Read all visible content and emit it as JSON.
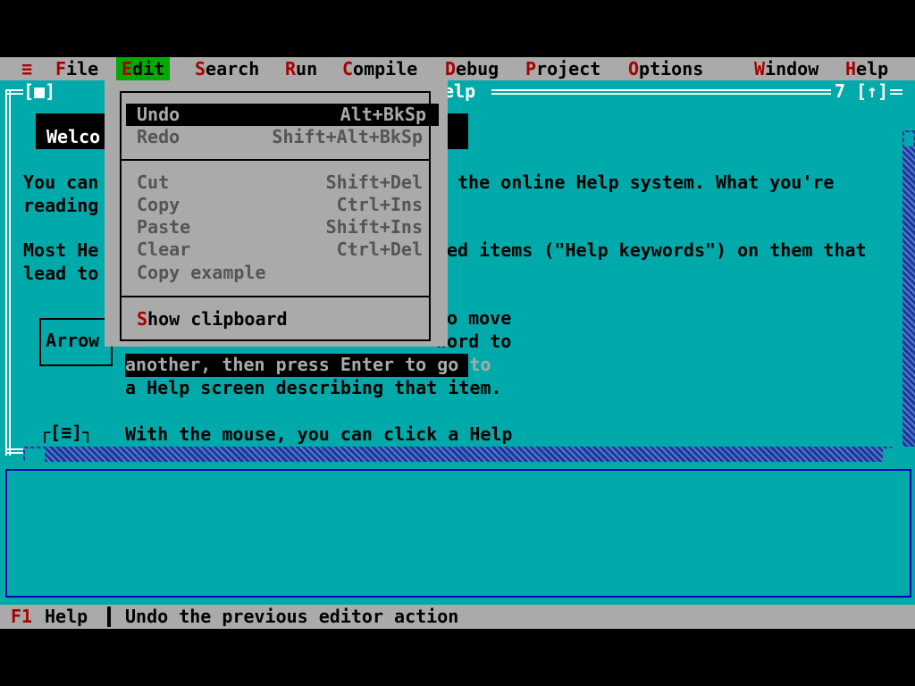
{
  "menubar": {
    "system_icon": "≡",
    "items": [
      {
        "hot": "F",
        "rest": "ile"
      },
      {
        "hot": "E",
        "rest": "dit"
      },
      {
        "hot": "S",
        "rest": "earch"
      },
      {
        "hot": "R",
        "rest": "un"
      },
      {
        "hot": "C",
        "rest": "ompile"
      },
      {
        "hot": "D",
        "rest": "ebug"
      },
      {
        "hot": "P",
        "rest": "roject"
      },
      {
        "hot": "O",
        "rest": "ptions"
      },
      {
        "hot": "W",
        "rest": "indow"
      },
      {
        "hot": "H",
        "rest": "elp"
      }
    ]
  },
  "help_window": {
    "title_fragment": "elp",
    "close_box": "[■]",
    "window_number": "7",
    "zoom_box": "[↑]",
    "welcome_fragment": "Welco",
    "text_line1_left": "You can",
    "text_line1_right": "the online Help system. What you're",
    "text_line2_left": "reading",
    "text_line3_left": "Most He",
    "text_line3_right": "ed items (\"Help keywords\") on them that",
    "text_line4_left": "lead to",
    "arrow_box_label": "Arrow",
    "para_line1": "o move",
    "para_line2": "word to",
    "para_line3": "another, then press Enter to go to",
    "para_line4": "a Help screen describing that item.",
    "mouse_icon": "[≡]",
    "mouse_line": "With the mouse, you can click a Help"
  },
  "edit_menu": {
    "items": [
      {
        "label": "Undo",
        "shortcut": "Alt+BkSp",
        "selected": true
      },
      {
        "label": "Redo",
        "shortcut": "Shift+Alt+BkSp"
      },
      {
        "label": "Cut",
        "shortcut": "Shift+Del"
      },
      {
        "label": "Copy",
        "shortcut": "Ctrl+Ins"
      },
      {
        "label": "Paste",
        "shortcut": "Shift+Ins"
      },
      {
        "label": "Clear",
        "shortcut": "Ctrl+Del"
      },
      {
        "label": "Copy example",
        "shortcut": ""
      },
      {
        "hot": "S",
        "rest": "how clipboard",
        "shortcut": ""
      }
    ]
  },
  "statusbar": {
    "key": "F1",
    "key_label": "Help",
    "hint": "Undo the previous editor action"
  },
  "colors": {
    "background": "#000000",
    "desktop": "#00aaaa",
    "menu": "#aaaaaa",
    "hotkey": "#aa0000",
    "active_menu": "#00aa00",
    "scrollbar": "#1a4fb0"
  }
}
